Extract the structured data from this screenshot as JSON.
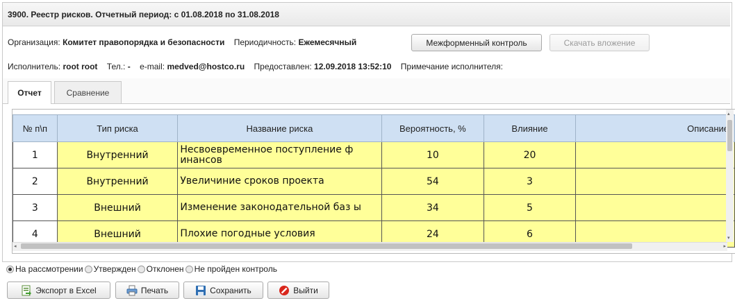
{
  "window": {
    "title": "3900. Реестр рисков. Отчетный период: с 01.08.2018 по 31.08.2018"
  },
  "info": {
    "org_label": "Организация:",
    "org_value": "Комитет правопорядка и безопасности",
    "period_label": "Периодичность:",
    "period_value": "Ежемесячный",
    "crossform_button": "Межформенный контроль",
    "download_button": "Скачать вложение",
    "executor_label": "Исполнитель:",
    "executor_value": "root root",
    "phone_label": "Тел.:",
    "phone_value": "-",
    "email_label": "e-mail:",
    "email_value": "medved@hostco.ru",
    "submitted_label": "Предоставлен:",
    "submitted_value": "12.09.2018 13:52:10",
    "note_label": "Примечание исполнителя:"
  },
  "tabs": [
    {
      "label": "Отчет",
      "active": true
    },
    {
      "label": "Сравнение",
      "active": false
    }
  ],
  "table": {
    "headers": [
      "№ п\\п",
      "Тип риска",
      "Название риска",
      "Вероятность, %",
      "Влияние",
      "Описание"
    ],
    "rows": [
      {
        "n": "1",
        "type": "Внутренний",
        "name": "Несвоевременное поступление ф инансов",
        "prob": "10",
        "impact": "20",
        "desc": ""
      },
      {
        "n": "2",
        "type": "Внутренний",
        "name": "Увеличиние сроков проекта",
        "prob": "54",
        "impact": "3",
        "desc": ""
      },
      {
        "n": "3",
        "type": "Внешний",
        "name": "Изменение законодательной баз ы",
        "prob": "34",
        "impact": "5",
        "desc": ""
      },
      {
        "n": "4",
        "type": "Внешний",
        "name": "Плохие погодные условия",
        "prob": "24",
        "impact": "6",
        "desc": ""
      }
    ]
  },
  "status": {
    "options": [
      "На рассмотрении",
      "Утвержден",
      "Отклонен",
      "Не пройден контроль"
    ],
    "selected": "На рассмотрении"
  },
  "buttons": {
    "export": "Экспорт в Excel",
    "print": "Печать",
    "save": "Сохранить",
    "exit": "Выйти"
  },
  "colors": {
    "header_bg": "#cfe0f3",
    "cell_yellow": "#ffff99",
    "exit_icon": "#d9261c",
    "save_icon": "#2f6fb3"
  }
}
